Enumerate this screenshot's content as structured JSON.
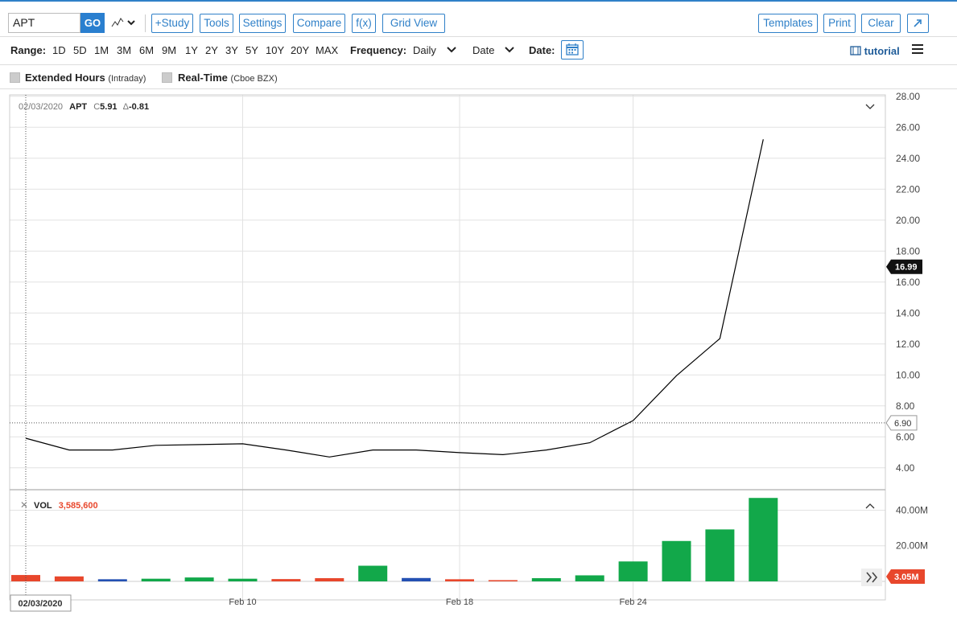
{
  "toolbar": {
    "symbol": "APT",
    "go_label": "GO",
    "study": "+Study",
    "tools": "Tools",
    "settings": "Settings",
    "compare": "Compare",
    "fx": "f(x)",
    "grid_view": "Grid View",
    "templates": "Templates",
    "print": "Print",
    "clear": "Clear"
  },
  "range_bar": {
    "range_label": "Range:",
    "ranges": [
      "1D",
      "5D",
      "1M",
      "3M",
      "6M",
      "9M",
      "1Y",
      "2Y",
      "3Y",
      "5Y",
      "10Y",
      "20Y",
      "MAX"
    ],
    "frequency_label": "Frequency:",
    "frequency_value": "Daily",
    "date_mode": "Date",
    "date_label": "Date:",
    "tutorial": "tutorial"
  },
  "options": {
    "extended_hours": "Extended Hours",
    "extended_hours_sub": "(Intraday)",
    "real_time": "Real-Time",
    "real_time_sub": "(Cboe BZX)"
  },
  "chart_data": {
    "type": "line",
    "legend": {
      "date": "02/03/2020",
      "symbol": "APT",
      "close_prefix": "C",
      "close": "5.91",
      "change_prefix": "Δ",
      "change": "-0.81"
    },
    "x": [
      "2020-02-03",
      "2020-02-04",
      "2020-02-05",
      "2020-02-06",
      "2020-02-07",
      "2020-02-10",
      "2020-02-11",
      "2020-02-12",
      "2020-02-13",
      "2020-02-14",
      "2020-02-18",
      "2020-02-19",
      "2020-02-20",
      "2020-02-21",
      "2020-02-24",
      "2020-02-25",
      "2020-02-26",
      "2020-02-27"
    ],
    "close": [
      5.91,
      5.15,
      5.15,
      5.45,
      5.5,
      5.55,
      5.15,
      4.7,
      5.15,
      5.15,
      4.98,
      4.85,
      5.15,
      5.62,
      7.05,
      9.95,
      12.35,
      25.22
    ],
    "volume": [
      3585600,
      2800000,
      1200000,
      1500000,
      2200000,
      1500000,
      1300000,
      1800000,
      8800000,
      1900000,
      1200000,
      700000,
      1800000,
      3400000,
      11200000,
      22700000,
      29200000,
      46900000
    ],
    "volume_colors": [
      "#e8472c",
      "#e8472c",
      "#2451b3",
      "#12a84a",
      "#12a84a",
      "#12a84a",
      "#e8472c",
      "#e8472c",
      "#12a84a",
      "#2451b3",
      "#e8472c",
      "#e8472c",
      "#12a84a",
      "#12a84a",
      "#12a84a",
      "#12a84a",
      "#12a84a",
      "#12a84a"
    ],
    "x_ticks": [
      {
        "date": "2020-02-10",
        "label": "Feb 10"
      },
      {
        "date": "2020-02-18",
        "label": "Feb 18"
      },
      {
        "date": "2020-02-24",
        "label": "Feb 24"
      }
    ],
    "price_ticks": [
      "28.00",
      "26.00",
      "24.00",
      "22.00",
      "20.00",
      "18.00",
      "16.00",
      "14.00",
      "12.00",
      "10.00",
      "8.00",
      "6.00",
      "4.00"
    ],
    "price_ylim": [
      3.0,
      28.3
    ],
    "volume_ticks": [
      "40.00M",
      "20.00M"
    ],
    "volume_ylim": [
      0,
      47000000
    ],
    "last_price_label": "16.99",
    "crosshair_price_label": "6.90",
    "crosshair_price": 6.9,
    "crosshair_date_label": "02/03/2020",
    "volume_legend_label": "VOL",
    "volume_legend_value": "3,585,600",
    "last_volume_label": "3.05M",
    "grid": true,
    "line_color": "#000000",
    "up_color": "#12a84a",
    "down_color": "#e8472c",
    "flat_color": "#2451b3"
  }
}
